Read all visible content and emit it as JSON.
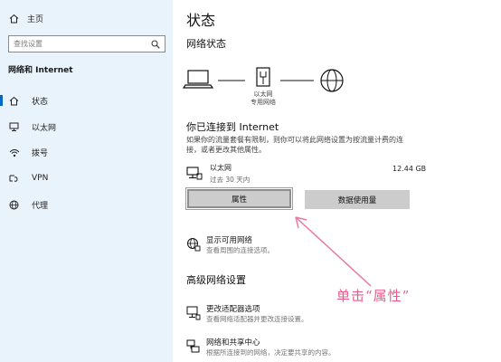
{
  "sidebar": {
    "home_label": "主页",
    "search_placeholder": "查找设置",
    "section_label": "网络和 Internet",
    "items": [
      {
        "label": "状态",
        "icon": "home-status-icon",
        "active": true
      },
      {
        "label": "以太网",
        "icon": "ethernet-icon"
      },
      {
        "label": "拨号",
        "icon": "dialup-icon"
      },
      {
        "label": "VPN",
        "icon": "vpn-icon"
      },
      {
        "label": "代理",
        "icon": "globe-icon"
      }
    ]
  },
  "main": {
    "page_title": "状态",
    "network_status_title": "网络状态",
    "diagram": {
      "adapter_line1": "以太网",
      "adapter_line2": "专用网络"
    },
    "connected_title": "你已连接到 Internet",
    "connected_desc": "如果你的流量套餐有限制，则你可以将此网络设置为按流量计费的连接，或者更改其他属性。",
    "network": {
      "name": "以太网",
      "status": "过去 30 天内",
      "data_used": "12.44 GB"
    },
    "buttons": {
      "properties": "属性",
      "data_usage": "数据使用量"
    },
    "show_networks": {
      "title": "显示可用网络",
      "desc": "查看周围的连接选项。"
    },
    "advanced_title": "高级网络设置",
    "advanced_items": [
      {
        "title": "更改适配器选项",
        "desc": "查看网络适配器并更改连接设置。"
      },
      {
        "title": "网络和共享中心",
        "desc": "根据所连接到的网络，决定要共享的内容。"
      }
    ]
  },
  "annotation": {
    "text": "单击“属性”",
    "color": "#e85b8b"
  },
  "colors": {
    "sidebar_bg": "#e9f3fb",
    "accent": "#0067c0",
    "button_bg": "#cccccc"
  }
}
